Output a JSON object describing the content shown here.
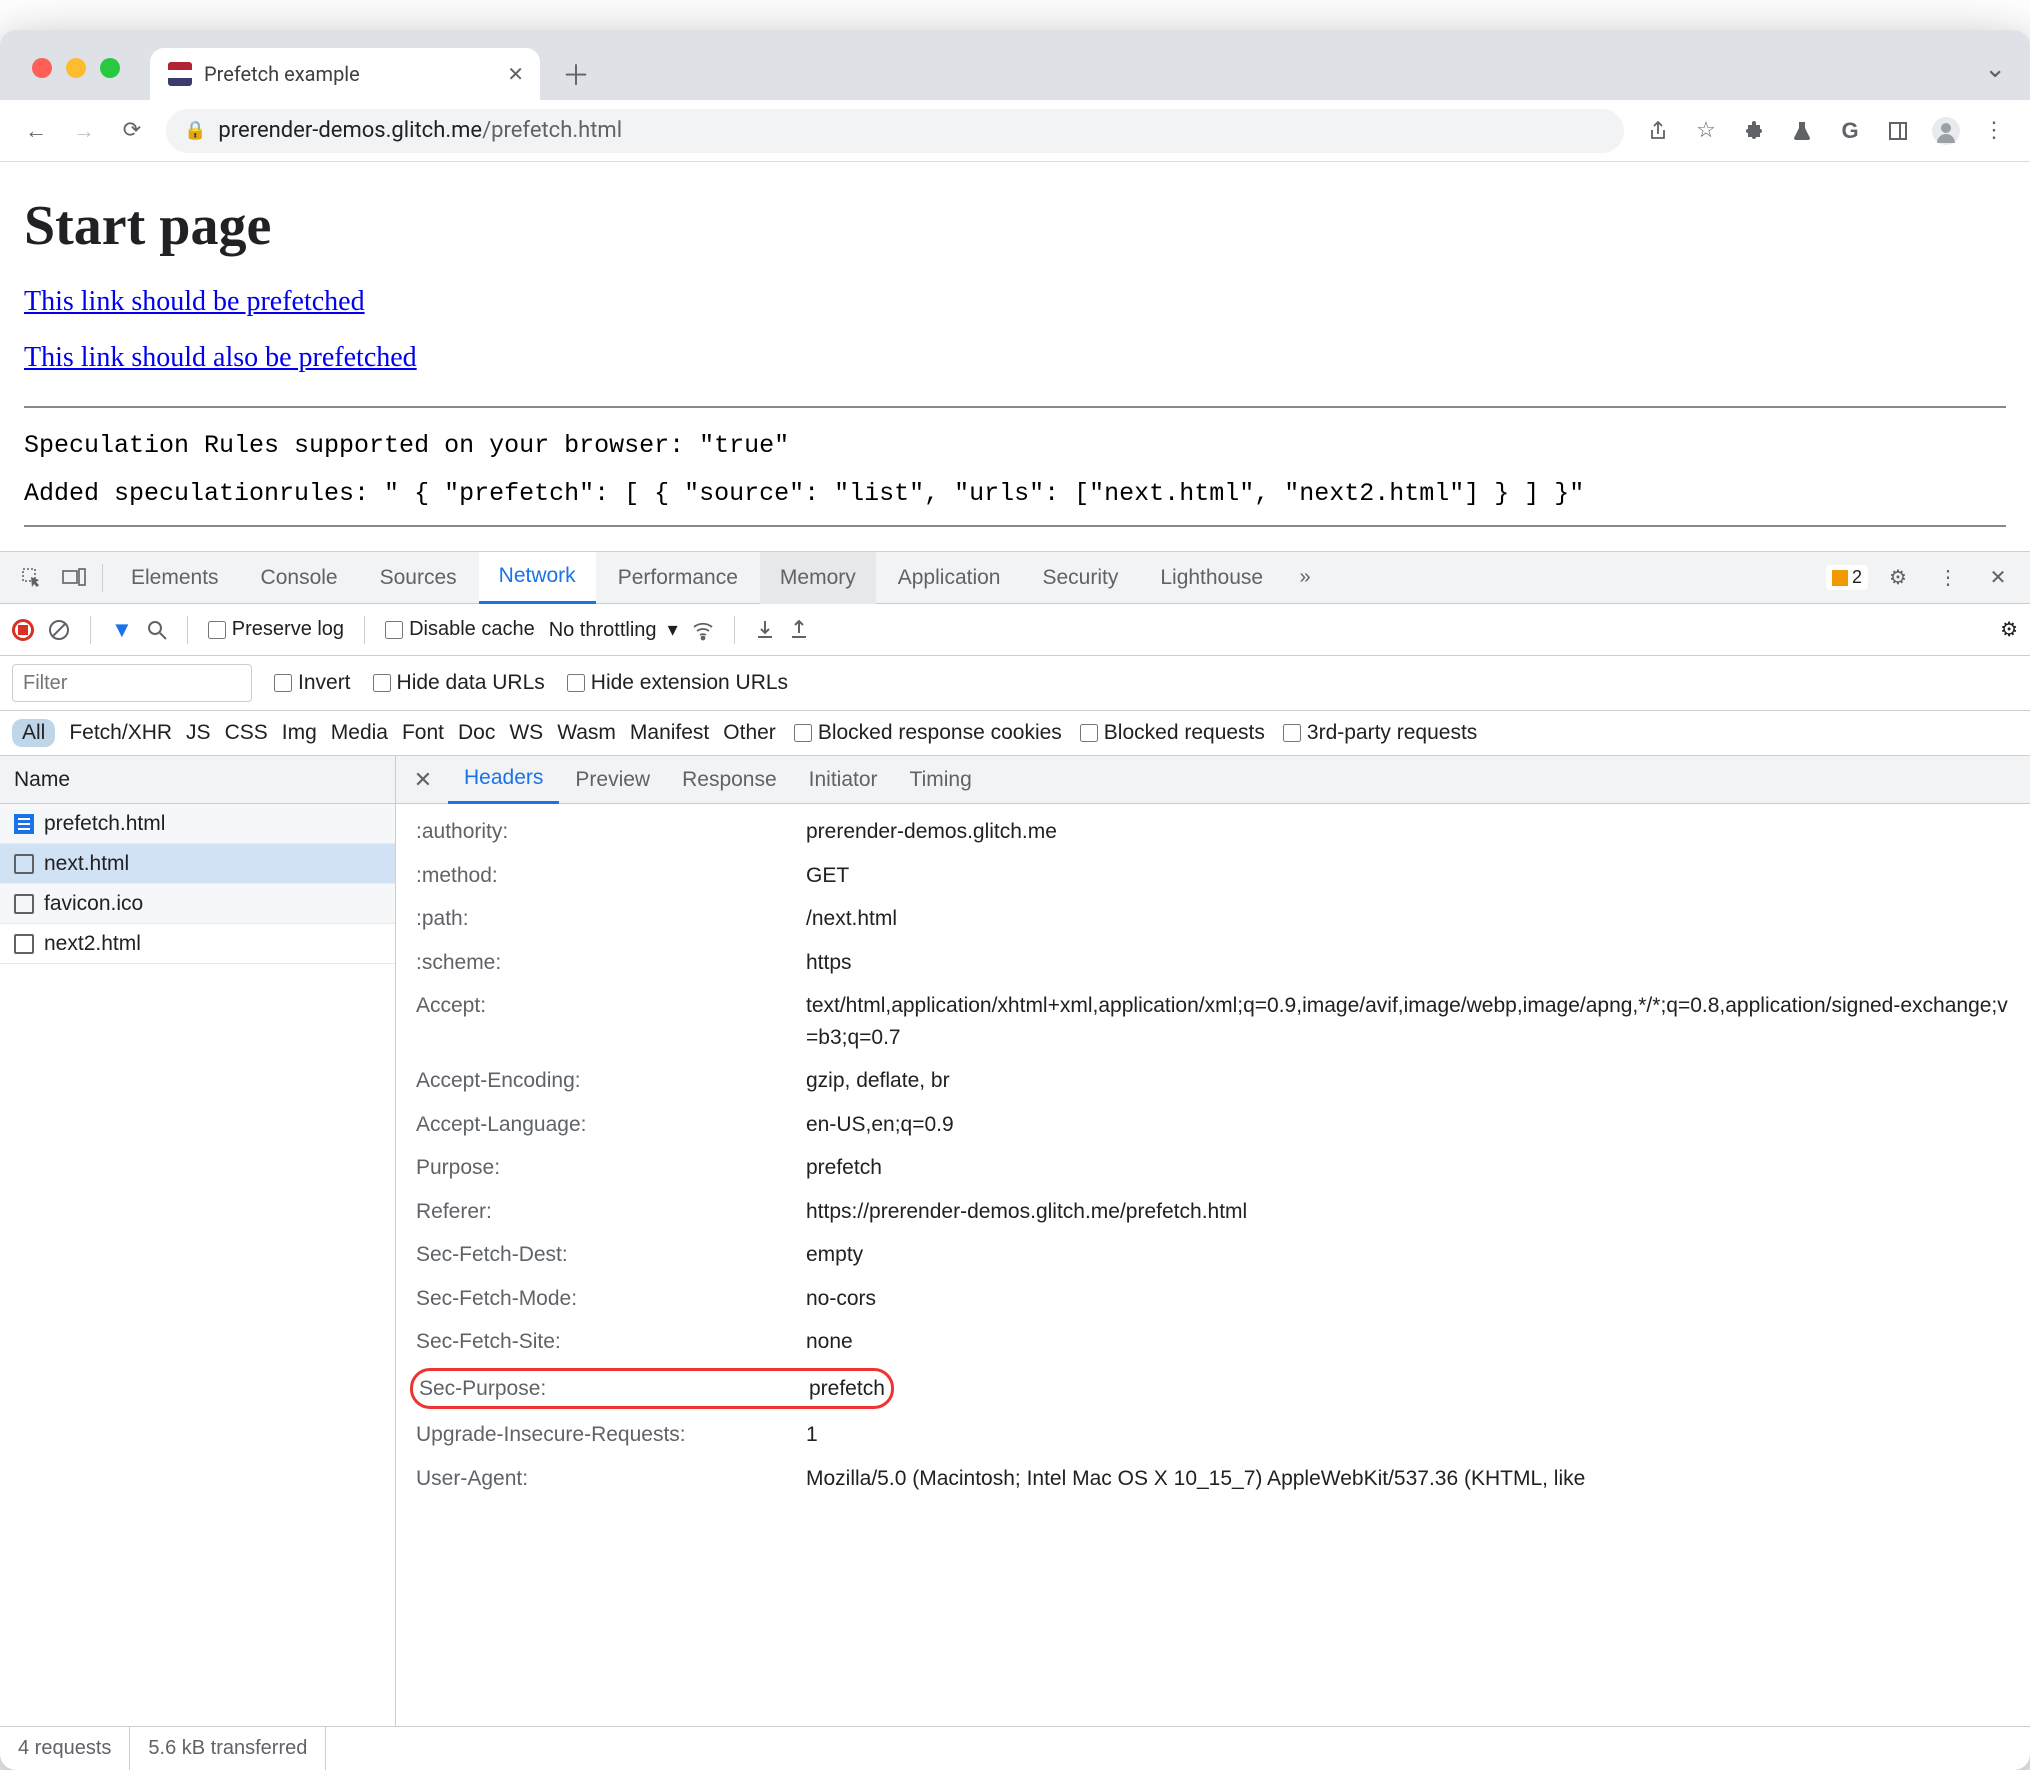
{
  "browser": {
    "tab_title": "Prefetch example",
    "url_host": "prerender-demos.glitch.me",
    "url_path": "/prefetch.html"
  },
  "page": {
    "heading": "Start page",
    "link1": "This link should be prefetched",
    "link2": "This link should also be prefetched",
    "log1": "Speculation Rules supported on your browser: \"true\"",
    "log2": "Added speculationrules: \" { \"prefetch\": [ { \"source\": \"list\", \"urls\": [\"next.html\", \"next2.html\"] } ] }\""
  },
  "devtools": {
    "tabs": [
      "Elements",
      "Console",
      "Sources",
      "Network",
      "Performance",
      "Memory",
      "Application",
      "Security",
      "Lighthouse"
    ],
    "active_tab": "Network",
    "hover_tab": "Memory",
    "warn_count": "2",
    "toolbar": {
      "preserve_log": "Preserve log",
      "disable_cache": "Disable cache",
      "throttling": "No throttling"
    },
    "filter": {
      "placeholder": "Filter",
      "invert": "Invert",
      "hide_data": "Hide data URLs",
      "hide_ext": "Hide extension URLs"
    },
    "types": [
      "All",
      "Fetch/XHR",
      "JS",
      "CSS",
      "Img",
      "Media",
      "Font",
      "Doc",
      "WS",
      "Wasm",
      "Manifest",
      "Other"
    ],
    "type_checks": {
      "blocked_cookies": "Blocked response cookies",
      "blocked_requests": "Blocked requests",
      "third_party": "3rd-party requests"
    },
    "name_header": "Name",
    "requests": [
      {
        "name": "prefetch.html",
        "icon": "doc",
        "sel": false
      },
      {
        "name": "next.html",
        "icon": "file",
        "sel": true
      },
      {
        "name": "favicon.ico",
        "icon": "file",
        "sel": false
      },
      {
        "name": "next2.html",
        "icon": "file",
        "sel": false
      }
    ],
    "detail_tabs": [
      "Headers",
      "Preview",
      "Response",
      "Initiator",
      "Timing"
    ],
    "detail_active": "Headers",
    "headers": [
      {
        "k": ":authority:",
        "v": "prerender-demos.glitch.me"
      },
      {
        "k": ":method:",
        "v": "GET"
      },
      {
        "k": ":path:",
        "v": "/next.html"
      },
      {
        "k": ":scheme:",
        "v": "https"
      },
      {
        "k": "Accept:",
        "v": "text/html,application/xhtml+xml,application/xml;q=0.9,image/avif,image/webp,image/apng,*/*;q=0.8,application/signed-exchange;v=b3;q=0.7"
      },
      {
        "k": "Accept-Encoding:",
        "v": "gzip, deflate, br"
      },
      {
        "k": "Accept-Language:",
        "v": "en-US,en;q=0.9"
      },
      {
        "k": "Purpose:",
        "v": "prefetch"
      },
      {
        "k": "Referer:",
        "v": "https://prerender-demos.glitch.me/prefetch.html"
      },
      {
        "k": "Sec-Fetch-Dest:",
        "v": "empty"
      },
      {
        "k": "Sec-Fetch-Mode:",
        "v": "no-cors"
      },
      {
        "k": "Sec-Fetch-Site:",
        "v": "none"
      },
      {
        "k": "Sec-Purpose:",
        "v": "prefetch",
        "hl": true
      },
      {
        "k": "Upgrade-Insecure-Requests:",
        "v": "1"
      },
      {
        "k": "User-Agent:",
        "v": "Mozilla/5.0 (Macintosh; Intel Mac OS X 10_15_7) AppleWebKit/537.36 (KHTML, like"
      }
    ],
    "status": {
      "requests": "4 requests",
      "transferred": "5.6 kB transferred"
    }
  }
}
